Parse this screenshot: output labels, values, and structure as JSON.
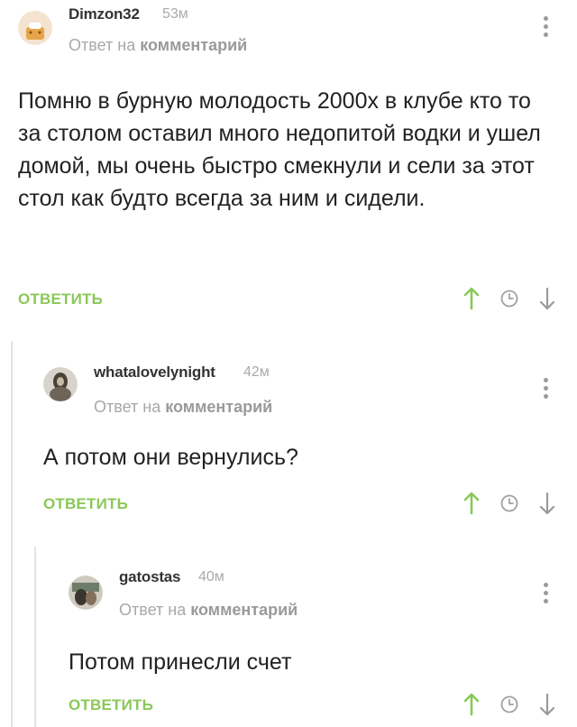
{
  "comments": [
    {
      "username": "Dimzon32",
      "time": "53м",
      "reply_prefix": "Ответ на",
      "reply_target": "комментарий",
      "text": "Помню в бурную молодость 2000х в клубе кто то за столом оставил много недопитой водки и ушел домой, мы очень быстро смекнули и сели за этот стол как будто всегда за ним и сидели.",
      "reply_label": "ОТВЕТИТЬ"
    },
    {
      "username": "whatalovelynight",
      "time": "42м",
      "reply_prefix": "Ответ на",
      "reply_target": "комментарий",
      "text": "А потом они вернулись?",
      "reply_label": "ОТВЕТИТЬ"
    },
    {
      "username": "gatostas",
      "time": "40м",
      "reply_prefix": "Ответ на",
      "reply_target": "комментарий",
      "text": "Потом принесли счет",
      "reply_label": "ОТВЕТИТЬ"
    }
  ],
  "colors": {
    "accent_green": "#8ac858",
    "muted_gray": "#a8a8a8",
    "thread_line": "#e3e3e3"
  },
  "icons": [
    "upvote-arrow-icon",
    "clock-icon",
    "downvote-arrow-icon",
    "more-vertical-icon"
  ]
}
